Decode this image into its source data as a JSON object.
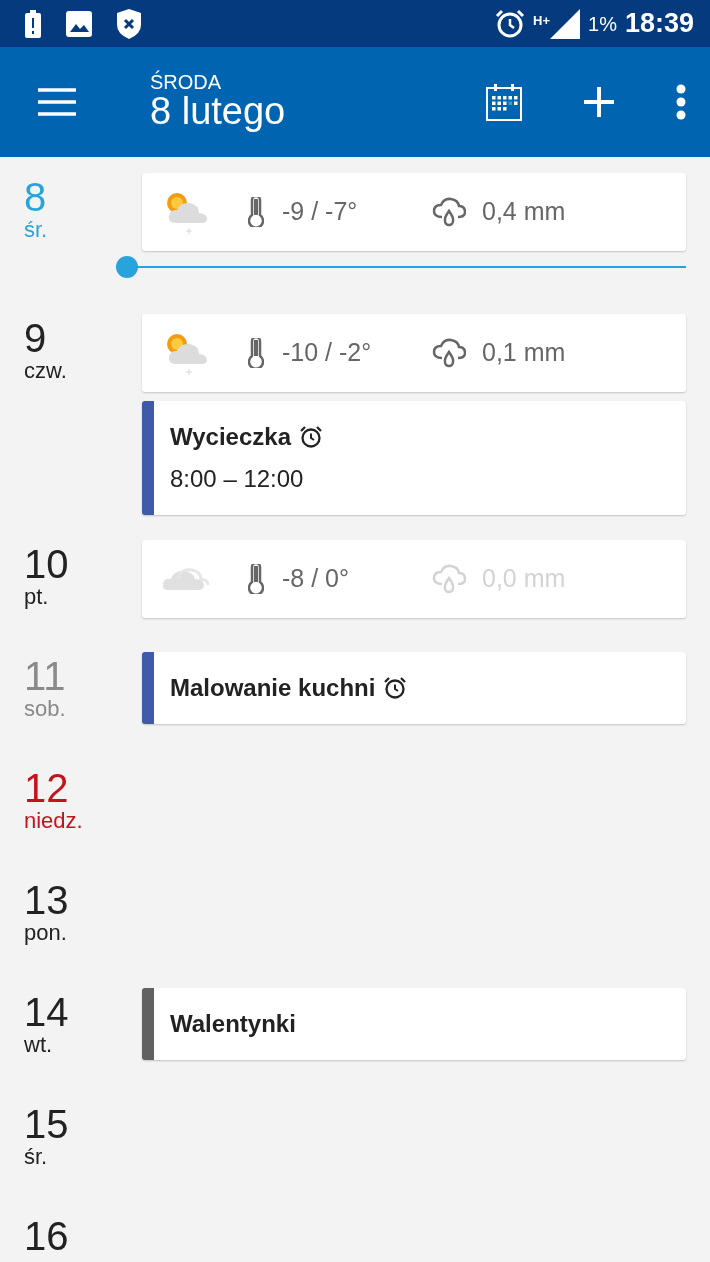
{
  "status_bar": {
    "battery_percent": "1%",
    "time": "18:39",
    "network": "H+"
  },
  "app_bar": {
    "weekday": "ŚRODA",
    "date": "8 lutego"
  },
  "days": [
    {
      "number": "8",
      "weekday": "śr.",
      "color": "#29a3dc",
      "now_marker": true,
      "items": [
        {
          "kind": "weather",
          "sun": true,
          "temp": "-9 / -7°",
          "precip": "0,4 mm",
          "dimmed": false
        }
      ]
    },
    {
      "number": "9",
      "weekday": "czw.",
      "color": "#222222",
      "items": [
        {
          "kind": "weather",
          "sun": true,
          "temp": "-10 / -2°",
          "precip": "0,1 mm",
          "dimmed": false
        },
        {
          "kind": "event",
          "title": "Wycieczka",
          "time": "8:00 – 12:00",
          "alarm": true,
          "color": "#3f5aa8"
        }
      ]
    },
    {
      "number": "10",
      "weekday": "pt.",
      "color": "#222222",
      "items": [
        {
          "kind": "weather",
          "sun": false,
          "temp": "-8 / 0°",
          "precip": "0,0 mm",
          "dimmed": true
        }
      ]
    },
    {
      "number": "11",
      "weekday": "sob.",
      "color": "#8a8a8a",
      "items": [
        {
          "kind": "event",
          "title": "Malowanie kuchni",
          "alarm": true,
          "color": "#3f5aa8"
        }
      ]
    },
    {
      "number": "12",
      "weekday": "niedz.",
      "color": "#c4141b"
    },
    {
      "number": "13",
      "weekday": "pon.",
      "color": "#222222"
    },
    {
      "number": "14",
      "weekday": "wt.",
      "color": "#222222",
      "items": [
        {
          "kind": "event",
          "title": "Walentynki",
          "color": "#616161"
        }
      ]
    },
    {
      "number": "15",
      "weekday": "śr.",
      "color": "#222222"
    },
    {
      "number": "16",
      "color": "#222222"
    }
  ]
}
